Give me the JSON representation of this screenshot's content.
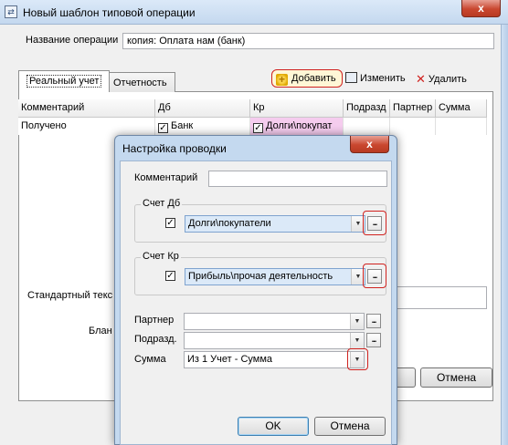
{
  "window": {
    "title": "Новый шаблон типовой операции",
    "close_glyph": "x"
  },
  "form": {
    "name_label": "Название операции",
    "name_value": "копия: Оплата нам (банк)"
  },
  "tabs": [
    {
      "label": "Реальный учет",
      "active": true
    },
    {
      "label": "Отчетность",
      "active": false
    }
  ],
  "toolbar": {
    "add_label": "Добавить",
    "edit_label": "Изменить",
    "delete_label": "Удалить"
  },
  "grid": {
    "columns": [
      "Комментарий",
      "Дб",
      "Кр",
      "Подразд",
      "Партнер",
      "Сумма"
    ],
    "rows": [
      {
        "comment": "Получено",
        "db": "Банк",
        "db_checked": true,
        "kr": "Долги\\покупат",
        "kr_checked": true
      }
    ]
  },
  "lower": {
    "standard_text_label": "Стандартный текс",
    "blank_label": "Блан",
    "cancel_label": "Отмена"
  },
  "dialog": {
    "title": "Настройка проводки",
    "close_glyph": "x",
    "comment_label": "Комментарий",
    "comment_value": "",
    "db_group": "Счет Дб",
    "db_value": "Долги\\покупатели",
    "db_checked": true,
    "kr_group": "Счет Кр",
    "kr_value": "Прибыль\\прочая деятельность",
    "kr_checked": true,
    "partner_label": "Партнер",
    "partner_value": "",
    "dept_label": "Подразд.",
    "dept_value": "",
    "sum_label": "Сумма",
    "sum_value": "Из 1 Учет - Сумма",
    "ok_label": "OK",
    "cancel_label": "Отмена",
    "ellipsis": "..."
  },
  "colors": {
    "highlight": "#d0221f",
    "selection": "#dbe9f8",
    "kr_cell": "#f5ccee"
  }
}
